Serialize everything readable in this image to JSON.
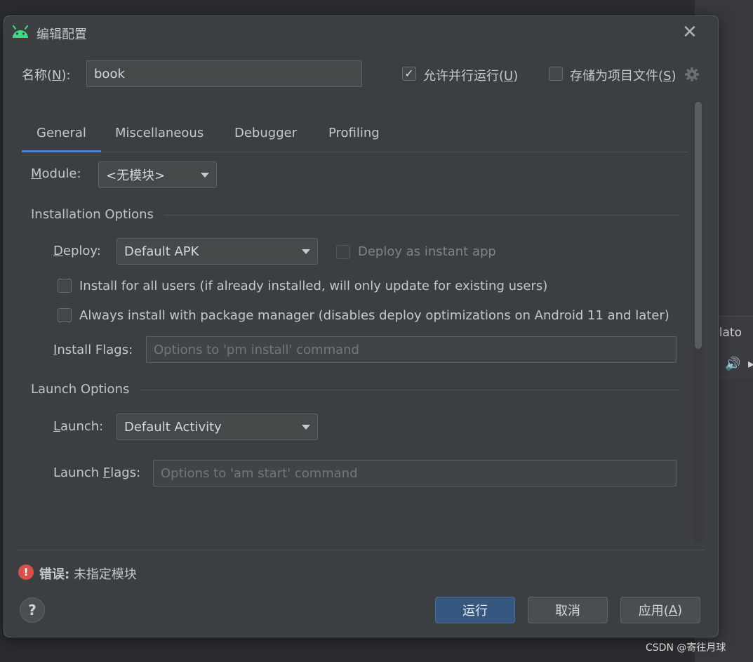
{
  "dialog": {
    "title": "编辑配置",
    "close_glyph": "✕",
    "name_label_pre": "名称(",
    "name_label_mn": "N",
    "name_label_post": "):",
    "name_value": "book",
    "allow_parallel": {
      "label_pre": "允许并行运行(",
      "mn": "U",
      "label_post": ")",
      "checked": true
    },
    "store_as_file": {
      "label_pre": "存储为项目文件(",
      "mn": "S",
      "label_post": ")",
      "checked": false
    }
  },
  "tabs": [
    {
      "label": "General",
      "active": true
    },
    {
      "label": "Miscellaneous",
      "active": false
    },
    {
      "label": "Debugger",
      "active": false
    },
    {
      "label": "Profiling",
      "active": false
    }
  ],
  "module": {
    "label_mn": "M",
    "label_rest": "odule:",
    "value": "<无模块>"
  },
  "installation": {
    "title": "Installation Options",
    "deploy_label_mn": "D",
    "deploy_label_rest": "eploy:",
    "deploy_value": "Default APK",
    "instant_app_label": "Deploy as instant app",
    "install_all_users": "Install for all users (if already installed, will only update for existing users)",
    "always_install_pm": "Always install with package manager (disables deploy optimizations on Android 11 and later)",
    "install_flags_label_mn": "I",
    "install_flags_label_rest": "nstall Flags:",
    "install_flags_placeholder": "Options to 'pm install' command"
  },
  "launch": {
    "title": "Launch Options",
    "launch_label_mn": "L",
    "launch_label_rest": "aunch:",
    "launch_value": "Default Activity",
    "flags_label_pre": "Launch ",
    "flags_label_mn": "F",
    "flags_label_rest": "lags:",
    "flags_placeholder": "Options to 'am start' command"
  },
  "error": {
    "prefix": "错误:",
    "message": " 未指定模块"
  },
  "buttons": {
    "help": "?",
    "run": "运行",
    "cancel": "取消",
    "apply_pre": "应用(",
    "apply_mn": "A",
    "apply_post": ")"
  },
  "background": {
    "panel_text": "ulato",
    "watermark": "CSDN @寄往月球"
  },
  "colors": {
    "accent": "#4a88c7",
    "primary_button": "#365880",
    "error": "#d8504b",
    "android": "#3ddc84"
  }
}
